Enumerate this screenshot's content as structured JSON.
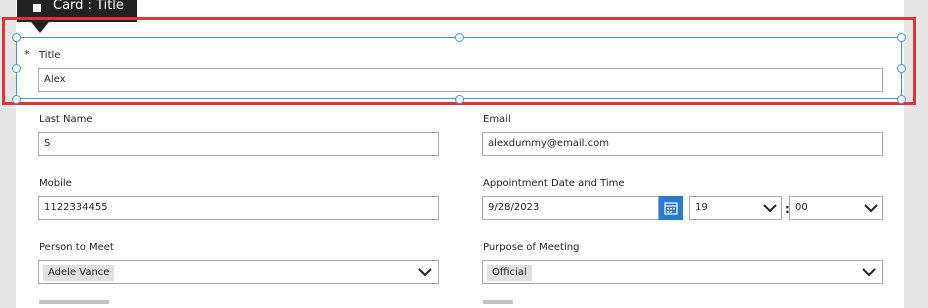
{
  "tooltip": {
    "text": "Card : Title"
  },
  "form": {
    "title": {
      "required_mark": "*",
      "label": "Title",
      "value": "Alex"
    },
    "last_name": {
      "label": "Last Name",
      "value": "S"
    },
    "email": {
      "label": "Email",
      "value": "alexdummy@email.com"
    },
    "mobile": {
      "label": "Mobile",
      "value": "1122334455"
    },
    "appointment": {
      "label": "Appointment Date and Time",
      "date": "9/28/2023",
      "hour": "19",
      "minute": "00",
      "separator": ":"
    },
    "person_to_meet": {
      "label": "Person to Meet",
      "value": "Adele Vance"
    },
    "purpose": {
      "label": "Purpose of Meeting",
      "value": "Official"
    }
  },
  "colors": {
    "selection": "#4a90d9",
    "highlight": "#e0323a",
    "accent": "#2b78d0"
  }
}
